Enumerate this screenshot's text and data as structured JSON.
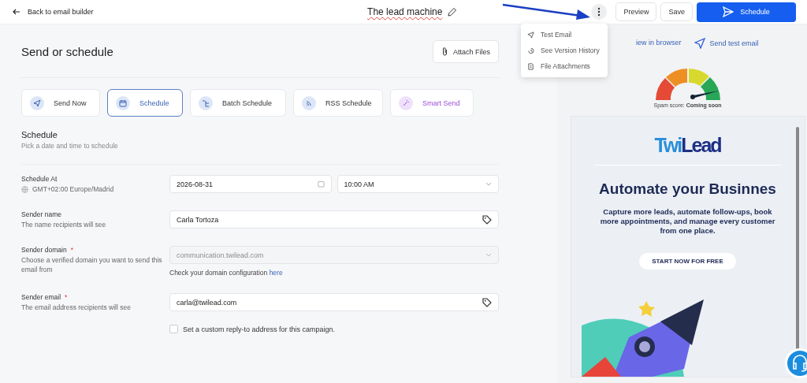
{
  "header": {
    "back": "Back to email builder",
    "title": "The lead machine",
    "buttons": {
      "preview": "Preview",
      "save": "Save",
      "primary": "Schedule"
    }
  },
  "menu": {
    "open": true,
    "items": [
      {
        "label": "Test Email"
      },
      {
        "label": "See Version History"
      },
      {
        "label": "File Attachments"
      }
    ]
  },
  "main": {
    "title": "Send or schedule",
    "attach": "Attach Files",
    "modes": [
      {
        "label": "Send Now",
        "kind": "standard",
        "selected": false
      },
      {
        "label": "Schedule",
        "kind": "standard",
        "selected": true
      },
      {
        "label": "Batch Schedule",
        "kind": "standard",
        "selected": false
      },
      {
        "label": "RSS Schedule",
        "kind": "standard",
        "selected": false
      },
      {
        "label": "Smart Send",
        "kind": "smart",
        "selected": false
      }
    ],
    "section": {
      "title": "Schedule",
      "subtitle": "Pick a date and time to schedule"
    },
    "rows": [
      {
        "kind": "datetime",
        "label": "Schedule At",
        "hint": "GMT+02:00 Europe/Madrid",
        "date": "2026-08-31",
        "time": "10:00 AM"
      },
      {
        "kind": "text",
        "label": "Sender name",
        "hint": "The name recipients will see",
        "value": "Carla Tortoza"
      },
      {
        "kind": "select",
        "label": "Sender domain",
        "hint": "Choose a verified domain you want to send this email from",
        "placeholder": "communication.twilead.com",
        "note": "Check your domain configuration",
        "link": "here",
        "required_mark": "*"
      },
      {
        "kind": "text",
        "label": "Sender email",
        "hint": "The email address recipients will see",
        "value": "carla@twilead.com",
        "required_mark": "*",
        "checkbox": {
          "label": "Set a custom reply-to address for this campaign.",
          "checked": false
        }
      }
    ]
  },
  "preview": {
    "links": [
      "iew in browser",
      "Send test email"
    ],
    "spam": "Spam score: **Coming soon**",
    "email": {
      "logo_a": "Twi",
      "logo_b": "Lead",
      "headline": "Automate your Businnes",
      "body": "Capture more leads, automate follow-ups, book more appointments, and manage every customer from one place.",
      "cta": "START NOW FOR FREE"
    }
  }
}
